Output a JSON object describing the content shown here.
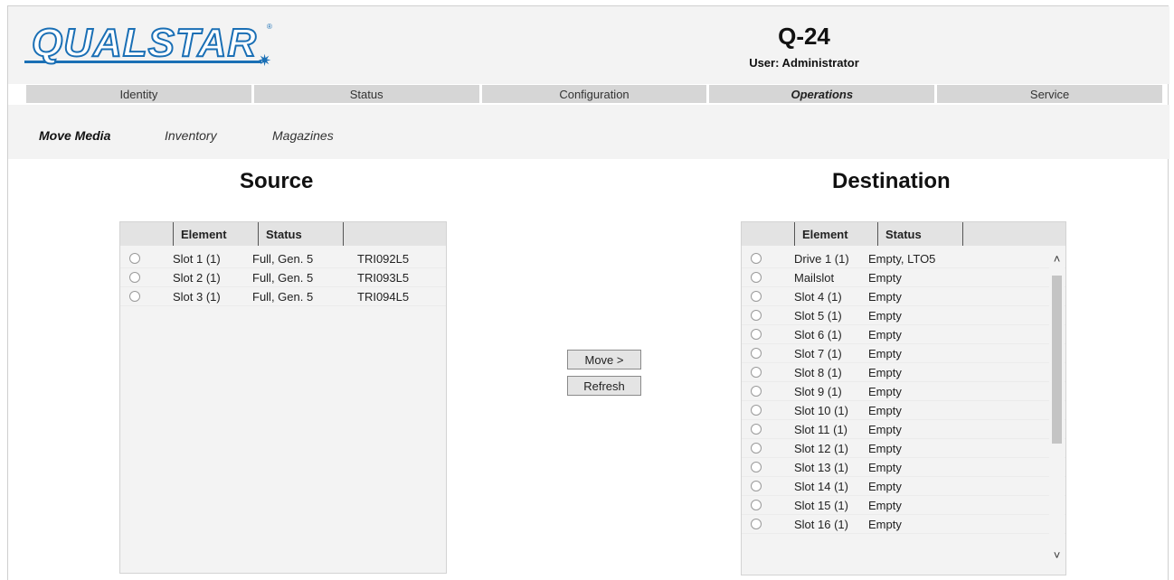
{
  "logo": {
    "text": "QUALSTAR",
    "tm": "®"
  },
  "header": {
    "title": "Q-24",
    "user": "User: Administrator"
  },
  "nav": [
    {
      "label": "Identity"
    },
    {
      "label": "Status"
    },
    {
      "label": "Configuration"
    },
    {
      "label": "Operations",
      "active": true
    },
    {
      "label": "Service"
    }
  ],
  "subnav": [
    {
      "label": "Move Media",
      "active": true
    },
    {
      "label": "Inventory"
    },
    {
      "label": "Magazines"
    }
  ],
  "source": {
    "title": "Source",
    "columns": [
      "Element",
      "Status"
    ],
    "rows": [
      {
        "element": "Slot 1 (1)",
        "status": "Full, Gen. 5",
        "barcode": "TRI092L5"
      },
      {
        "element": "Slot 2 (1)",
        "status": "Full, Gen. 5",
        "barcode": "TRI093L5"
      },
      {
        "element": "Slot 3 (1)",
        "status": "Full, Gen. 5",
        "barcode": "TRI094L5"
      }
    ]
  },
  "actions": {
    "move": "Move >",
    "refresh": "Refresh"
  },
  "destination": {
    "title": "Destination",
    "columns": [
      "Element",
      "Status"
    ],
    "rows": [
      {
        "element": "Drive 1 (1)",
        "status": "Empty, LTO5"
      },
      {
        "element": "Mailslot",
        "status": "Empty"
      },
      {
        "element": "Slot 4 (1)",
        "status": "Empty"
      },
      {
        "element": "Slot 5 (1)",
        "status": "Empty"
      },
      {
        "element": "Slot 6 (1)",
        "status": "Empty"
      },
      {
        "element": "Slot 7 (1)",
        "status": "Empty"
      },
      {
        "element": "Slot 8 (1)",
        "status": "Empty"
      },
      {
        "element": "Slot 9 (1)",
        "status": "Empty"
      },
      {
        "element": "Slot 10 (1)",
        "status": "Empty"
      },
      {
        "element": "Slot 11 (1)",
        "status": "Empty"
      },
      {
        "element": "Slot 12 (1)",
        "status": "Empty"
      },
      {
        "element": "Slot 13 (1)",
        "status": "Empty"
      },
      {
        "element": "Slot 14 (1)",
        "status": "Empty"
      },
      {
        "element": "Slot 15 (1)",
        "status": "Empty"
      },
      {
        "element": "Slot 16 (1)",
        "status": "Empty"
      }
    ],
    "scroll_up": "˄",
    "scroll_down": "˅"
  }
}
